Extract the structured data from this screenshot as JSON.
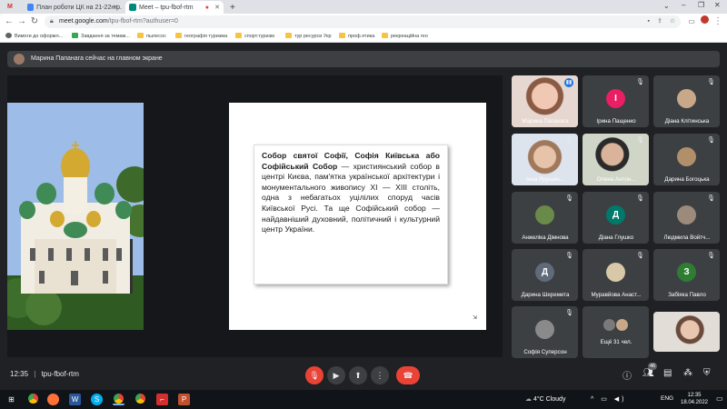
{
  "browser": {
    "tabs": [
      {
        "label": "M",
        "color": "#d93025"
      },
      {
        "label": "План роботи ЦК на 21-22н.р.",
        "color": "#4285f4"
      },
      {
        "label": "Meet – tpu-fbof-rtm",
        "color": "#00897b"
      }
    ],
    "new_tab": "+",
    "url_domain": "meet.google.com",
    "url_path": "/tpu-fbof-rtm?authuser=0",
    "bookmarks": [
      "Вимоги до оформл...",
      "Завдання за темам...",
      "пылесос",
      "географія туризма",
      "спорт.туризм",
      "тур ресурси Укр",
      "проф.ятика",
      "рекреаційна гео"
    ]
  },
  "meet": {
    "presenting_banner": "Марина Папанага сейчас на главном экране",
    "slide": {
      "bold_text": "Собор святої Софії, Софія Київська або Софійський Собор",
      "body_text": " — християнський собор в центрі Києва, пам'ятка української архітектури і монументального живопису XI — XIII століть, одна з небагатьох уцілілих споруд часів Київської Русі. Та ще Софійський собор — найдавніший духовний, політичний і культурний центр України."
    },
    "participants": [
      {
        "name": "Марина Папанага",
        "type": "video",
        "avatar": ""
      },
      {
        "name": "Ірина Пащенко",
        "type": "avatar",
        "avatar": "І",
        "color": "#e91e63"
      },
      {
        "name": "Діана Клітинська",
        "type": "photo",
        "avatar": ""
      },
      {
        "name": "Інна Ярушин...",
        "type": "video",
        "avatar": ""
      },
      {
        "name": "Олена Антон...",
        "type": "video",
        "avatar": ""
      },
      {
        "name": "Дарина Богоцька",
        "type": "photo",
        "avatar": ""
      },
      {
        "name": "Анжеліка Дімнова",
        "type": "photo",
        "avatar": ""
      },
      {
        "name": "Діана Глушко",
        "type": "avatar",
        "avatar": "Д",
        "color": "#00796b"
      },
      {
        "name": "Людмила Войтч...",
        "type": "photo",
        "avatar": ""
      },
      {
        "name": "Дарина Шеремета",
        "type": "avatar",
        "avatar": "Д",
        "color": "#5f6b7a"
      },
      {
        "name": "Муравйова Анаст...",
        "type": "photo",
        "avatar": ""
      },
      {
        "name": "Забіяка Павло",
        "type": "avatar",
        "avatar": "З",
        "color": "#2e7d32"
      },
      {
        "name": "Софія Суперсон",
        "type": "photo",
        "avatar": ""
      },
      {
        "name": "Ещё 31 чел.",
        "type": "more",
        "avatar": ""
      },
      {
        "name": "",
        "type": "video",
        "avatar": ""
      }
    ],
    "time": "12:35",
    "meeting_code": "tpu-fbof-rtm",
    "people_count": "46"
  },
  "taskbar": {
    "temperature": "4°C",
    "weather": "Cloudy",
    "language": "ENG",
    "time": "12:35",
    "date": "18.04.2022"
  }
}
